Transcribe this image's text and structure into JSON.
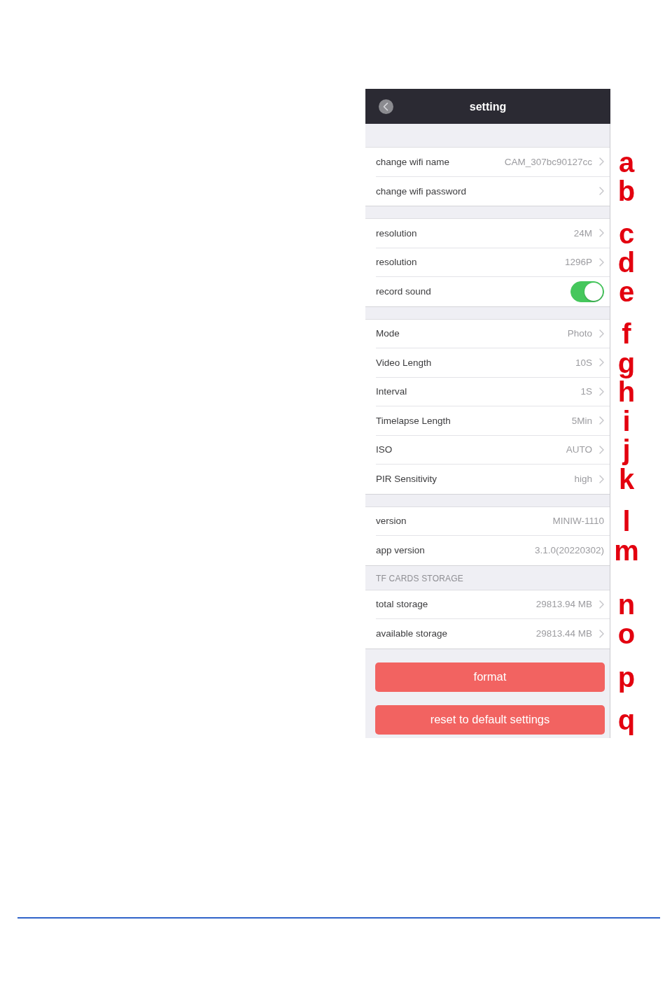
{
  "nav": {
    "title": "setting"
  },
  "groups": [
    {
      "rows": [
        {
          "kind": "disclosure",
          "label": "change wifi name",
          "value": "CAM_307bc90127cc",
          "marker": "a"
        },
        {
          "kind": "disclosure",
          "label": "change wifi password",
          "marker": "b"
        }
      ]
    },
    {
      "rows": [
        {
          "kind": "disclosure",
          "label": "resolution",
          "value": "24M",
          "marker": "c"
        },
        {
          "kind": "disclosure",
          "label": "resolution",
          "value": "1296P",
          "marker": "d"
        },
        {
          "kind": "toggle",
          "label": "record sound",
          "on": true,
          "marker": "e"
        }
      ]
    },
    {
      "rows": [
        {
          "kind": "disclosure",
          "label": "Mode",
          "value": "Photo",
          "marker": "f"
        },
        {
          "kind": "disclosure",
          "label": "Video Length",
          "value": "10S",
          "marker": "g"
        },
        {
          "kind": "disclosure",
          "label": "Interval",
          "value": "1S",
          "marker": "h"
        },
        {
          "kind": "disclosure",
          "label": "Timelapse Length",
          "value": "5Min",
          "marker": "i"
        },
        {
          "kind": "disclosure",
          "label": "ISO",
          "value": "AUTO",
          "marker": "j"
        },
        {
          "kind": "disclosure",
          "label": "PIR Sensitivity",
          "value": "high",
          "marker": "k"
        }
      ]
    },
    {
      "rows": [
        {
          "kind": "info",
          "label": "version",
          "value": "MINIW-1110",
          "marker": "l"
        },
        {
          "kind": "info",
          "label": "app version",
          "value": "3.1.0(20220302)",
          "marker": "m"
        }
      ]
    },
    {
      "header": "TF CARDS STORAGE",
      "rows": [
        {
          "kind": "disclosure",
          "label": "total storage",
          "value": "29813.94 MB",
          "marker": "n"
        },
        {
          "kind": "disclosure",
          "label": "available storage",
          "value": "29813.44 MB",
          "marker": "o"
        }
      ]
    }
  ],
  "buttons": [
    {
      "label": "format",
      "marker": "p"
    },
    {
      "label": "reset to default settings",
      "marker": "q"
    }
  ]
}
